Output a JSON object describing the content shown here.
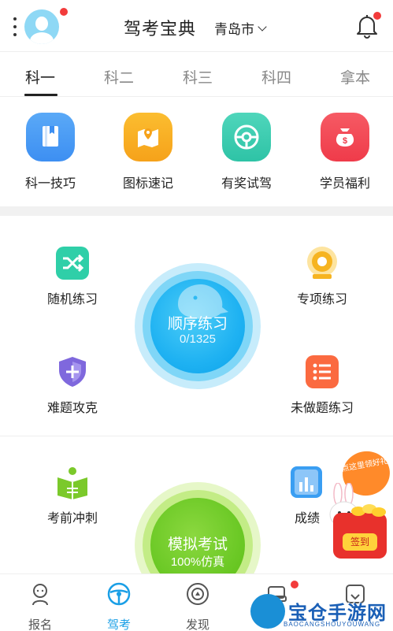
{
  "header": {
    "title": "驾考宝典",
    "city": "青岛市",
    "menu_icon": "more-vertical-icon",
    "avatar_icon": "user-avatar-icon",
    "bell_icon": "bell-icon"
  },
  "tabs": [
    {
      "label": "科一",
      "active": true
    },
    {
      "label": "科二",
      "active": false
    },
    {
      "label": "科三",
      "active": false
    },
    {
      "label": "科四",
      "active": false
    },
    {
      "label": "拿本",
      "active": false
    }
  ],
  "quick_links": [
    {
      "label": "科一技巧",
      "icon": "book-icon",
      "color": "#3d8ff2"
    },
    {
      "label": "图标速记",
      "icon": "map-pin-icon",
      "color": "#f6a21a"
    },
    {
      "label": "有奖试驾",
      "icon": "steering-wheel-icon",
      "color": "#2ec3a6"
    },
    {
      "label": "学员福利",
      "icon": "money-bag-icon",
      "color": "#ef3b4a"
    }
  ],
  "practice": {
    "random": {
      "label": "随机练习",
      "icon": "shuffle-icon",
      "color": "#2fcfa8"
    },
    "topic": {
      "label": "专项练习",
      "icon": "target-icon",
      "color": "#f6b421"
    },
    "hard": {
      "label": "难题攻克",
      "icon": "shield-icon",
      "color": "#7f68dd"
    },
    "undone": {
      "label": "未做题练习",
      "icon": "list-icon",
      "color": "#fb6a40"
    },
    "sequential": {
      "label": "顺序练习",
      "count": "0/1325"
    },
    "pre_exam": {
      "label": "考前冲刺",
      "icon": "book-open-icon",
      "color": "#7bc92b"
    },
    "score": {
      "label": "成绩",
      "icon": "bar-chart-icon",
      "color": "#3a9ef2"
    },
    "mock": {
      "label": "模拟考试",
      "sub": "100%仿真"
    }
  },
  "gift_badge": {
    "bubble": "点这里领好礼",
    "label": "签到"
  },
  "bottom_nav": [
    {
      "label": "报名",
      "icon": "person-icon",
      "active": false
    },
    {
      "label": "驾考",
      "icon": "steering-wheel-icon",
      "active": true
    },
    {
      "label": "发现",
      "icon": "discover-icon",
      "active": false
    },
    {
      "label": "",
      "icon": "car-icon",
      "active": false
    },
    {
      "label": "",
      "icon": "profile-icon",
      "active": false
    }
  ],
  "watermark": {
    "text": "宝仓手游网",
    "sub": "BAOCANGSHOUYOUWANG"
  },
  "colors": {
    "accent": "#1a9fe6",
    "badge": "#f23b3b",
    "seq": "#1fb2f2",
    "mock": "#6cc926"
  }
}
